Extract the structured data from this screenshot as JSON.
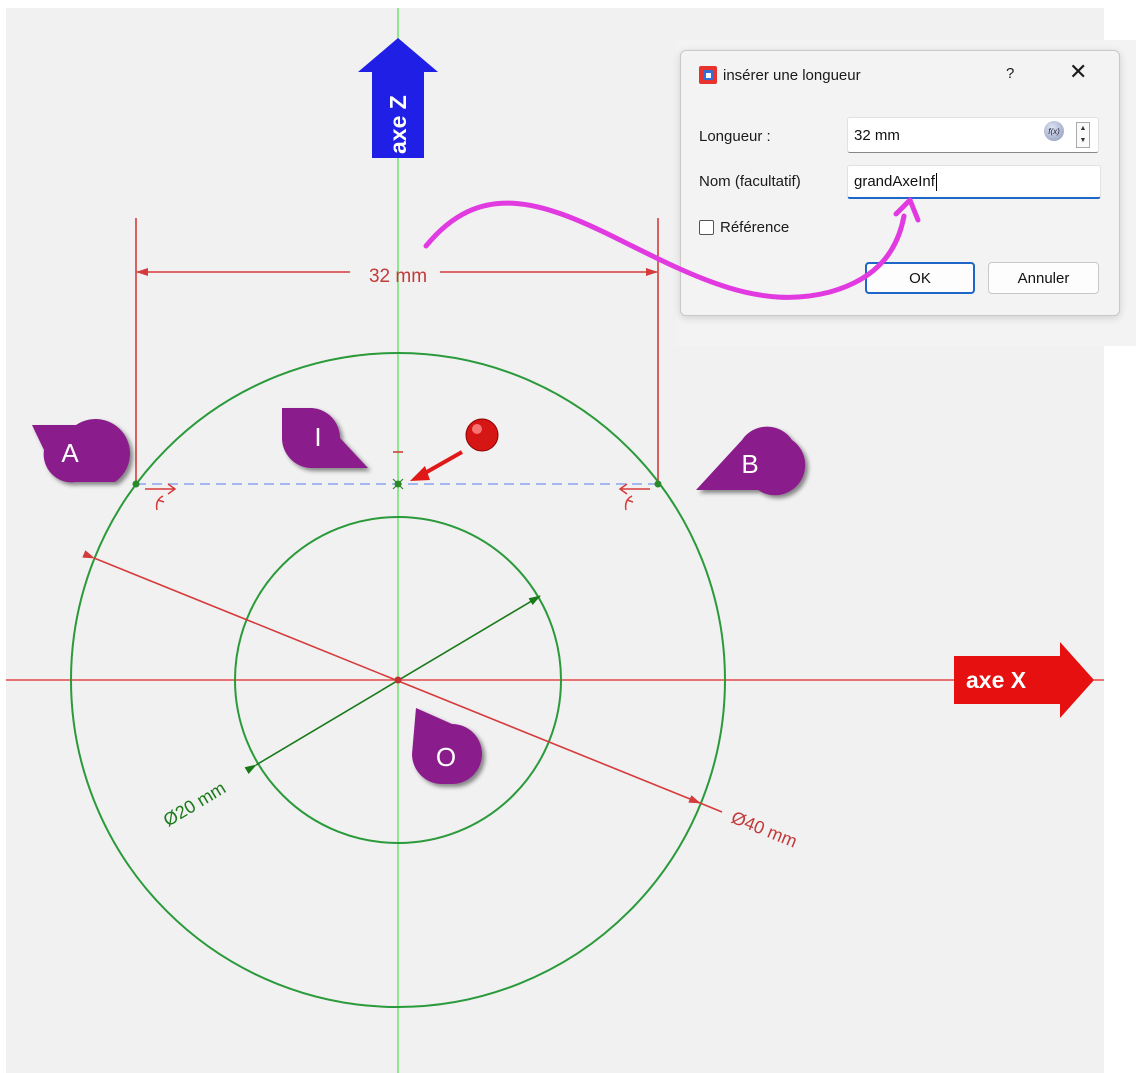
{
  "sketch": {
    "axis_z_label": "axe Z",
    "axis_x_label": "axe X",
    "dim_length": "32 mm",
    "dim_outer_diameter": "Ø40 mm",
    "dim_inner_diameter": "Ø20 mm",
    "point_A": "A",
    "point_B": "B",
    "point_I": "I",
    "point_O": "O",
    "colors": {
      "background": "#f1f1f1",
      "z_axis": "#6fe36f",
      "x_axis": "#e24848",
      "geometry": "#2a9a3a",
      "dimension": "#d63b3b",
      "marker": "#8b1a8b",
      "arrow_label_z": "#1f1fe6",
      "arrow_label_x": "#e61010",
      "curve": "#e03ae0"
    }
  },
  "dialog": {
    "title": "insérer une longueur",
    "help": "?",
    "close": "✕",
    "length_label": "Longueur :",
    "length_value": "32 mm",
    "name_label": "Nom (facultatif)",
    "name_value": "grandAxeInf",
    "reference_label": "Référence",
    "ok_label": "OK",
    "cancel_label": "Annuler"
  }
}
